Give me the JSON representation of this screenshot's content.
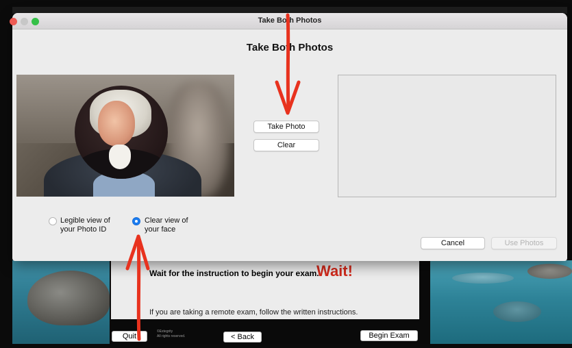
{
  "dialog": {
    "window_title": "Take Both Photos",
    "heading": "Take Both Photos",
    "take_photo_label": "Take Photo",
    "clear_label": "Clear",
    "radio_photo_id_line1": "Legible view of",
    "radio_photo_id_line2": "your Photo ID",
    "radio_face_line1": "Clear view of",
    "radio_face_line2": "your face",
    "selected_option": "face",
    "cancel_label": "Cancel",
    "use_photos_label": "Use Photos"
  },
  "exam": {
    "instruction": "Wait for the instruction to begin your exam.",
    "wait_label": "Wait!",
    "remote_text": "If you are taking a remote exam, follow the written instructions.",
    "quit_label": "Quit",
    "copyright_line1": "©Extegrity",
    "copyright_line2": "All rights reserved.",
    "back_label": "< Back",
    "begin_label": "Begin Exam"
  },
  "colors": {
    "accent": "#1a7cf0",
    "annotation": "#e8321e",
    "wait": "#d22a1c"
  }
}
